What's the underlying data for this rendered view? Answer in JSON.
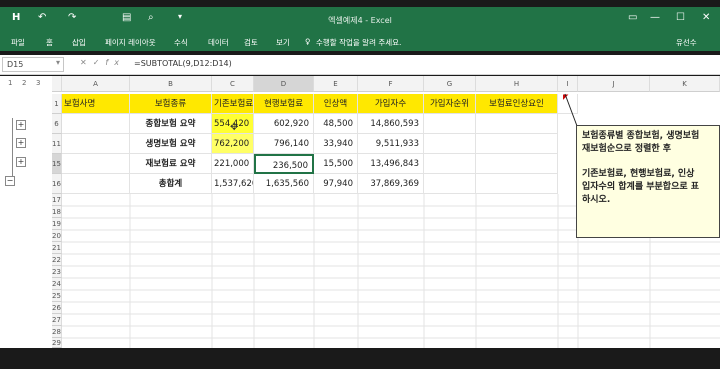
{
  "titlebar": {
    "title": "엑셀예제4 - Excel",
    "save_icon": "H",
    "undo_icon": "↶",
    "redo_icon": "↷",
    "minimize": "—",
    "maximize": "☐",
    "close": "✕"
  },
  "ribbon": {
    "tabs": [
      "파일",
      "홈",
      "삽입",
      "페이지 레이아웃",
      "수식",
      "데이터",
      "검토",
      "보기"
    ],
    "search_hint": "수행할 작업을 알려 주세요.",
    "user": "유선수"
  },
  "formulabar": {
    "name_box": "D15",
    "cancel_icon": "✕",
    "enter_icon": "✓",
    "fx_label": "fx",
    "formula": "=SUBTOTAL(9,D12:D14)"
  },
  "outline": {
    "levels": [
      "1",
      "2",
      "3"
    ],
    "plus": "+",
    "minus": "−"
  },
  "columns": [
    "A",
    "B",
    "C",
    "D",
    "E",
    "F",
    "G",
    "H",
    "I",
    "J",
    "K"
  ],
  "rows": [
    {
      "num": "1",
      "cells": [
        "보험사명",
        "보험종류",
        "기존보험료",
        "현행보험료",
        "인상액",
        "가입자수",
        "가입자순위",
        "보험료인상요인"
      ]
    },
    {
      "num": "6",
      "cells": [
        "",
        "종합보험 요약",
        "554,420",
        "602,920",
        "48,500",
        "14,860,593",
        "",
        ""
      ]
    },
    {
      "num": "11",
      "cells": [
        "",
        "생명보험 요약",
        "762,200",
        "796,140",
        "33,940",
        "9,511,933",
        "",
        ""
      ]
    },
    {
      "num": "15",
      "cells": [
        "",
        "재보험료 요약",
        "221,000",
        "236,500",
        "15,500",
        "13,496,843",
        "",
        ""
      ]
    },
    {
      "num": "16",
      "cells": [
        "",
        "총합계",
        "1,537,620",
        "1,635,560",
        "97,940",
        "37,869,369",
        "",
        ""
      ]
    },
    {
      "num": "17",
      "cells": []
    },
    {
      "num": "18",
      "cells": []
    },
    {
      "num": "19",
      "cells": []
    },
    {
      "num": "20",
      "cells": []
    },
    {
      "num": "21",
      "cells": []
    },
    {
      "num": "22",
      "cells": []
    },
    {
      "num": "23",
      "cells": []
    },
    {
      "num": "24",
      "cells": []
    },
    {
      "num": "25",
      "cells": []
    },
    {
      "num": "26",
      "cells": []
    },
    {
      "num": "27",
      "cells": []
    },
    {
      "num": "28",
      "cells": []
    },
    {
      "num": "29",
      "cells": []
    }
  ],
  "comment": {
    "line1": "보험종류별 종합보험, 생명보험",
    "line2": "재보험순으로 정렬한 후",
    "line3": "기존보험료, 현행보험료, 인상",
    "line4": "입자수의 합계를 부분합으로 표",
    "line5": "하시오."
  },
  "colors": {
    "excel_green": "#217346",
    "header_fill": "#ffe800",
    "comment_fill": "#ffffe1",
    "highlight": "#ffff00"
  }
}
